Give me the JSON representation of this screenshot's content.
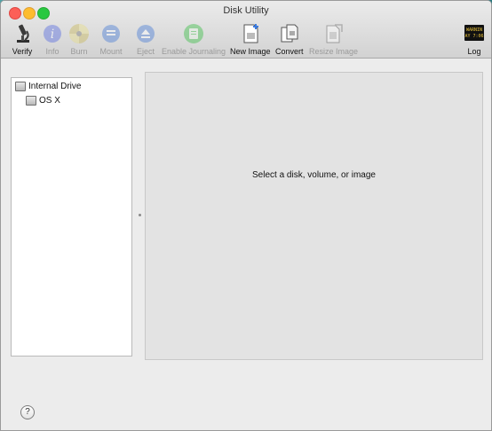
{
  "window": {
    "title": "Disk Utility"
  },
  "toolbar": {
    "items": [
      {
        "label": "Verify",
        "icon": "microscope-icon",
        "enabled": true
      },
      {
        "label": "Info",
        "icon": "info-icon",
        "enabled": false
      },
      {
        "label": "Burn",
        "icon": "burn-disc-icon",
        "enabled": false
      },
      {
        "label": "Mount",
        "icon": "mount-icon",
        "enabled": false
      },
      {
        "label": "Eject",
        "icon": "eject-icon",
        "enabled": false
      },
      {
        "label": "Enable Journaling",
        "icon": "journaling-icon",
        "enabled": false
      },
      {
        "label": "New Image",
        "icon": "new-image-icon",
        "enabled": true
      },
      {
        "label": "Convert",
        "icon": "convert-icon",
        "enabled": true
      },
      {
        "label": "Resize Image",
        "icon": "resize-image-icon",
        "enabled": false
      },
      {
        "label": "Log",
        "icon": "log-console-icon",
        "enabled": true
      }
    ],
    "log_screen_text": [
      "WARNIN",
      "AY 7:06"
    ]
  },
  "sidebar": {
    "items": [
      {
        "label": "Internal Drive",
        "level": 0
      },
      {
        "label": "OS X",
        "level": 1
      }
    ]
  },
  "detail": {
    "placeholder": "Select a disk, volume, or image"
  },
  "help": {
    "label": "?"
  }
}
